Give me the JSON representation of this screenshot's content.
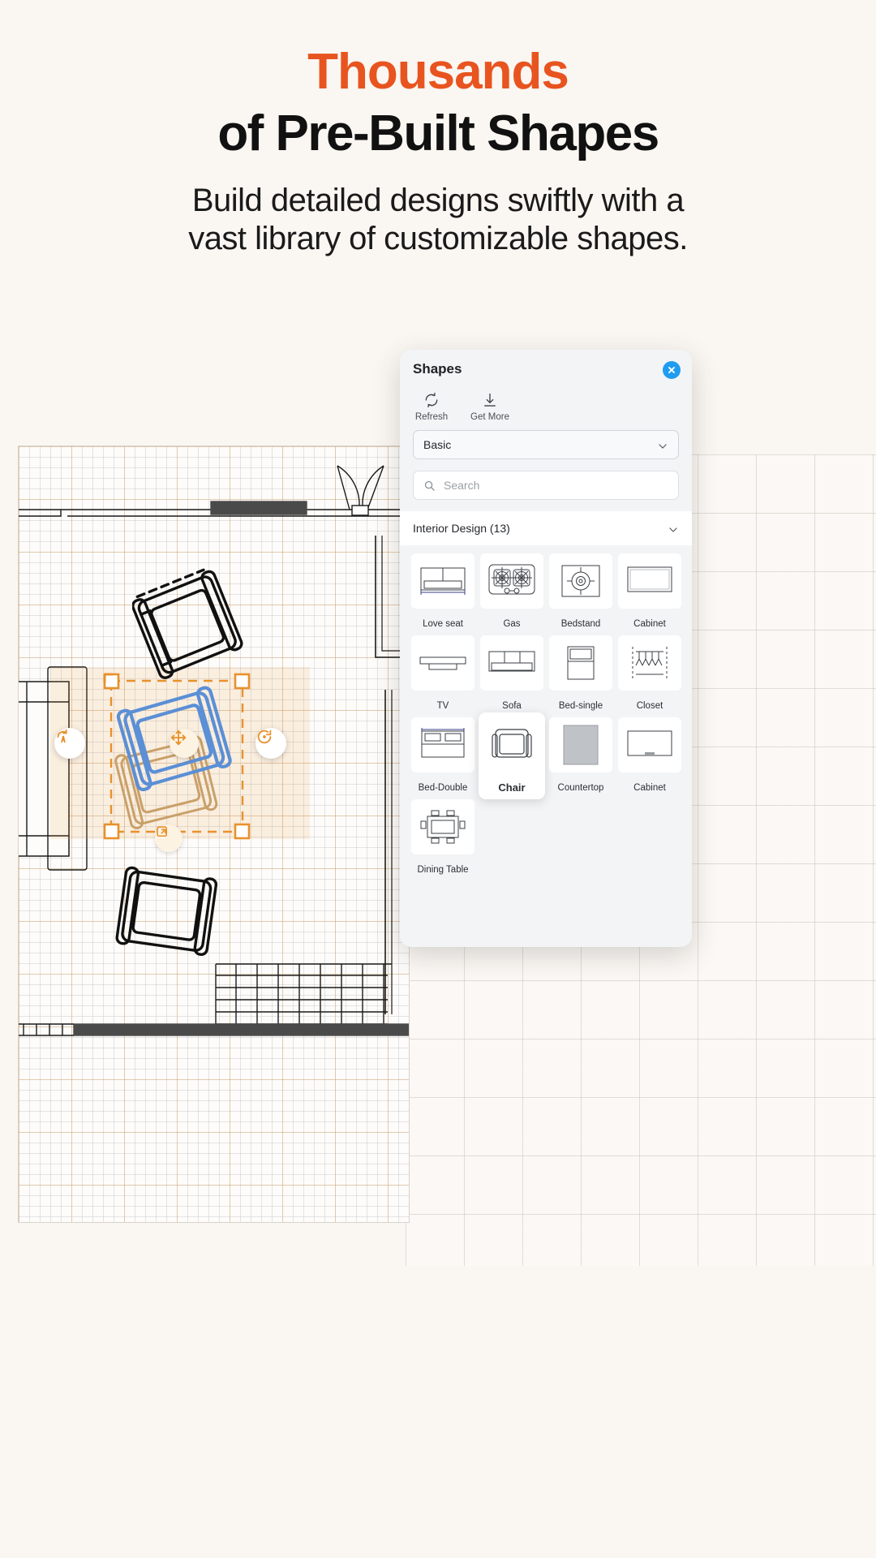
{
  "headline": {
    "line1": "Thousands",
    "line2": "of Pre-Built Shapes",
    "sub_line1": "Build detailed designs swiftly with a",
    "sub_line2": "vast library of customizable shapes."
  },
  "colors": {
    "accent_orange": "#e8541f",
    "page_bg": "#faf6f2",
    "close_blue": "#1f9cf0",
    "selection_orange": "#e8912b",
    "selected_shape_blue": "#5b8fd6"
  },
  "panel": {
    "title": "Shapes",
    "close_icon": "close-circle-icon",
    "tools": [
      {
        "label": "Refresh",
        "icon": "refresh-icon"
      },
      {
        "label": "Get More",
        "icon": "download-icon"
      }
    ],
    "library_select": {
      "value": "Basic",
      "icon": "chevron-down-icon"
    },
    "search": {
      "placeholder": "Search",
      "value": "",
      "icon": "search-icon"
    },
    "category": {
      "label": "Interior Design (13)",
      "icon": "chevron-down-icon"
    },
    "shapes": [
      {
        "label": "Love seat",
        "icon": "love-seat-shape",
        "selected": false
      },
      {
        "label": "Gas",
        "icon": "gas-stove-shape",
        "selected": false
      },
      {
        "label": "Bedstand",
        "icon": "bedstand-shape",
        "selected": false
      },
      {
        "label": "Cabinet",
        "icon": "cabinet-shape",
        "selected": false
      },
      {
        "label": "TV",
        "icon": "tv-shape",
        "selected": false
      },
      {
        "label": "Sofa",
        "icon": "sofa-shape",
        "selected": false
      },
      {
        "label": "Bed-single",
        "icon": "bed-single-shape",
        "selected": false
      },
      {
        "label": "Closet",
        "icon": "closet-shape",
        "selected": false
      },
      {
        "label": "Bed-Double",
        "icon": "bed-double-shape",
        "selected": false
      },
      {
        "label": "Chair",
        "icon": "chair-shape",
        "selected": true
      },
      {
        "label": "Countertop",
        "icon": "countertop-shape",
        "selected": false
      },
      {
        "label": "Cabinet",
        "icon": "cabinet-2-shape",
        "selected": false
      },
      {
        "label": "Dining Table",
        "icon": "dining-table-shape",
        "selected": false
      }
    ]
  }
}
